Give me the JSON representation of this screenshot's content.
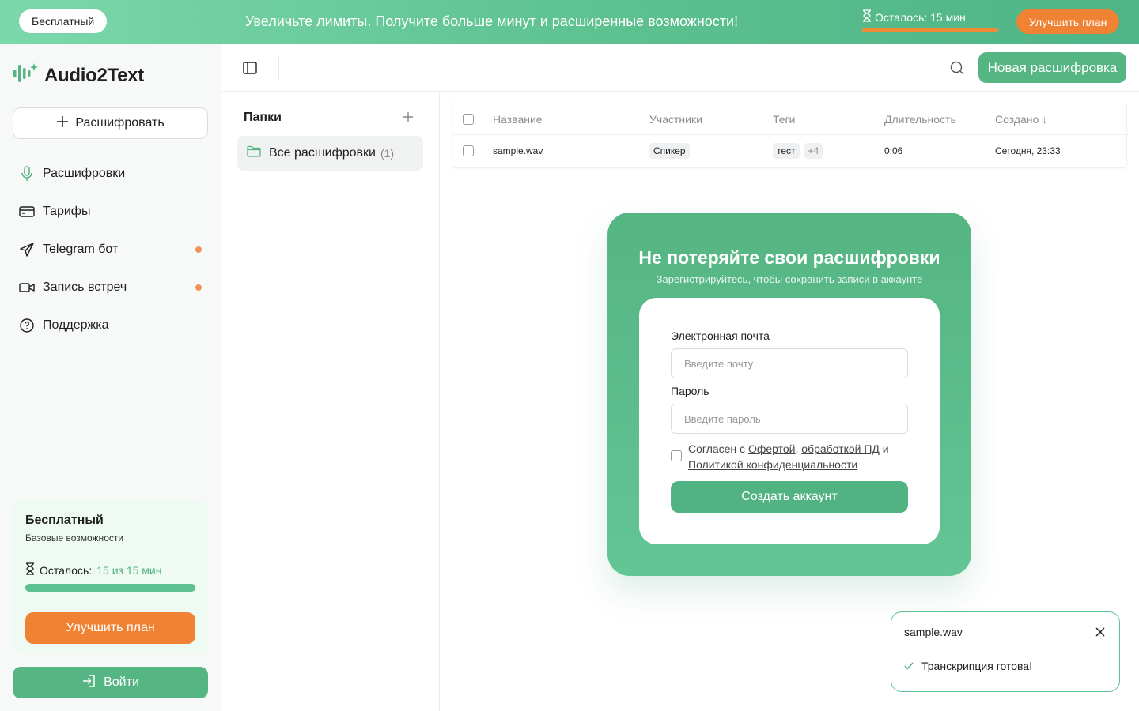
{
  "banner": {
    "plan_chip": "Бесплатный",
    "message": "Увеличьте лимиты. Получите больше минут и расширенные возможности!",
    "remaining_label": "Осталось: 15 мин",
    "remaining_fraction": 1.0,
    "upgrade_label": "Улучшить план"
  },
  "sidebar": {
    "app_name": "Audio2Text",
    "transcribe_label": "Расшифровать",
    "items": [
      {
        "label": "Расшифровки",
        "icon": "mic-icon"
      },
      {
        "label": "Тарифы",
        "icon": "card-icon"
      },
      {
        "label": "Telegram бот",
        "icon": "send-icon",
        "dot": true
      },
      {
        "label": "Запись встреч",
        "icon": "video-icon",
        "dot": true
      },
      {
        "label": "Поддержка",
        "icon": "help-icon"
      }
    ],
    "plan": {
      "name": "Бесплатный",
      "description": "Базовые возможности",
      "remaining_label": "Осталось:",
      "remaining_value": "15 из 15 мин",
      "remaining_fraction": 1.0,
      "upgrade_label": "Улучшить план"
    },
    "login_label": "Войти"
  },
  "topbar": {
    "new_label": "Новая расшифровка"
  },
  "folders": {
    "title": "Папки",
    "items": [
      {
        "label": "Все расшифровки",
        "count": "(1)"
      }
    ]
  },
  "table": {
    "columns": [
      "Название",
      "Участники",
      "Теги",
      "Длительность",
      "Создано ↓"
    ],
    "rows": [
      {
        "name": "sample.wav",
        "participant": "Спикер",
        "tag": "тест",
        "more_tags": "+4",
        "duration": "0:06",
        "created": "Сегодня, 23:33"
      }
    ]
  },
  "signup": {
    "title": "Не потеряйте свои расшифровки",
    "subtitle": "Зарегистрируйтесь, чтобы сохранить записи в аккаунте",
    "email_label": "Электронная почта",
    "email_placeholder": "Введите почту",
    "password_label": "Пароль",
    "password_placeholder": "Введите пароль",
    "agree_prefix": "Согласен с ",
    "offer_link": "Офертой",
    "comma": ", ",
    "pd_link": "обработкой ПД",
    "and": " и ",
    "privacy_link": "Политикой конфиденциальности",
    "create_label": "Создать аккаунт"
  },
  "toast": {
    "file": "sample.wav",
    "message": "Транскрипция готова!"
  },
  "colors": {
    "brand_green": "#55b583",
    "accent_orange": "#ef8233",
    "indicator_dot": "#f0935a"
  }
}
